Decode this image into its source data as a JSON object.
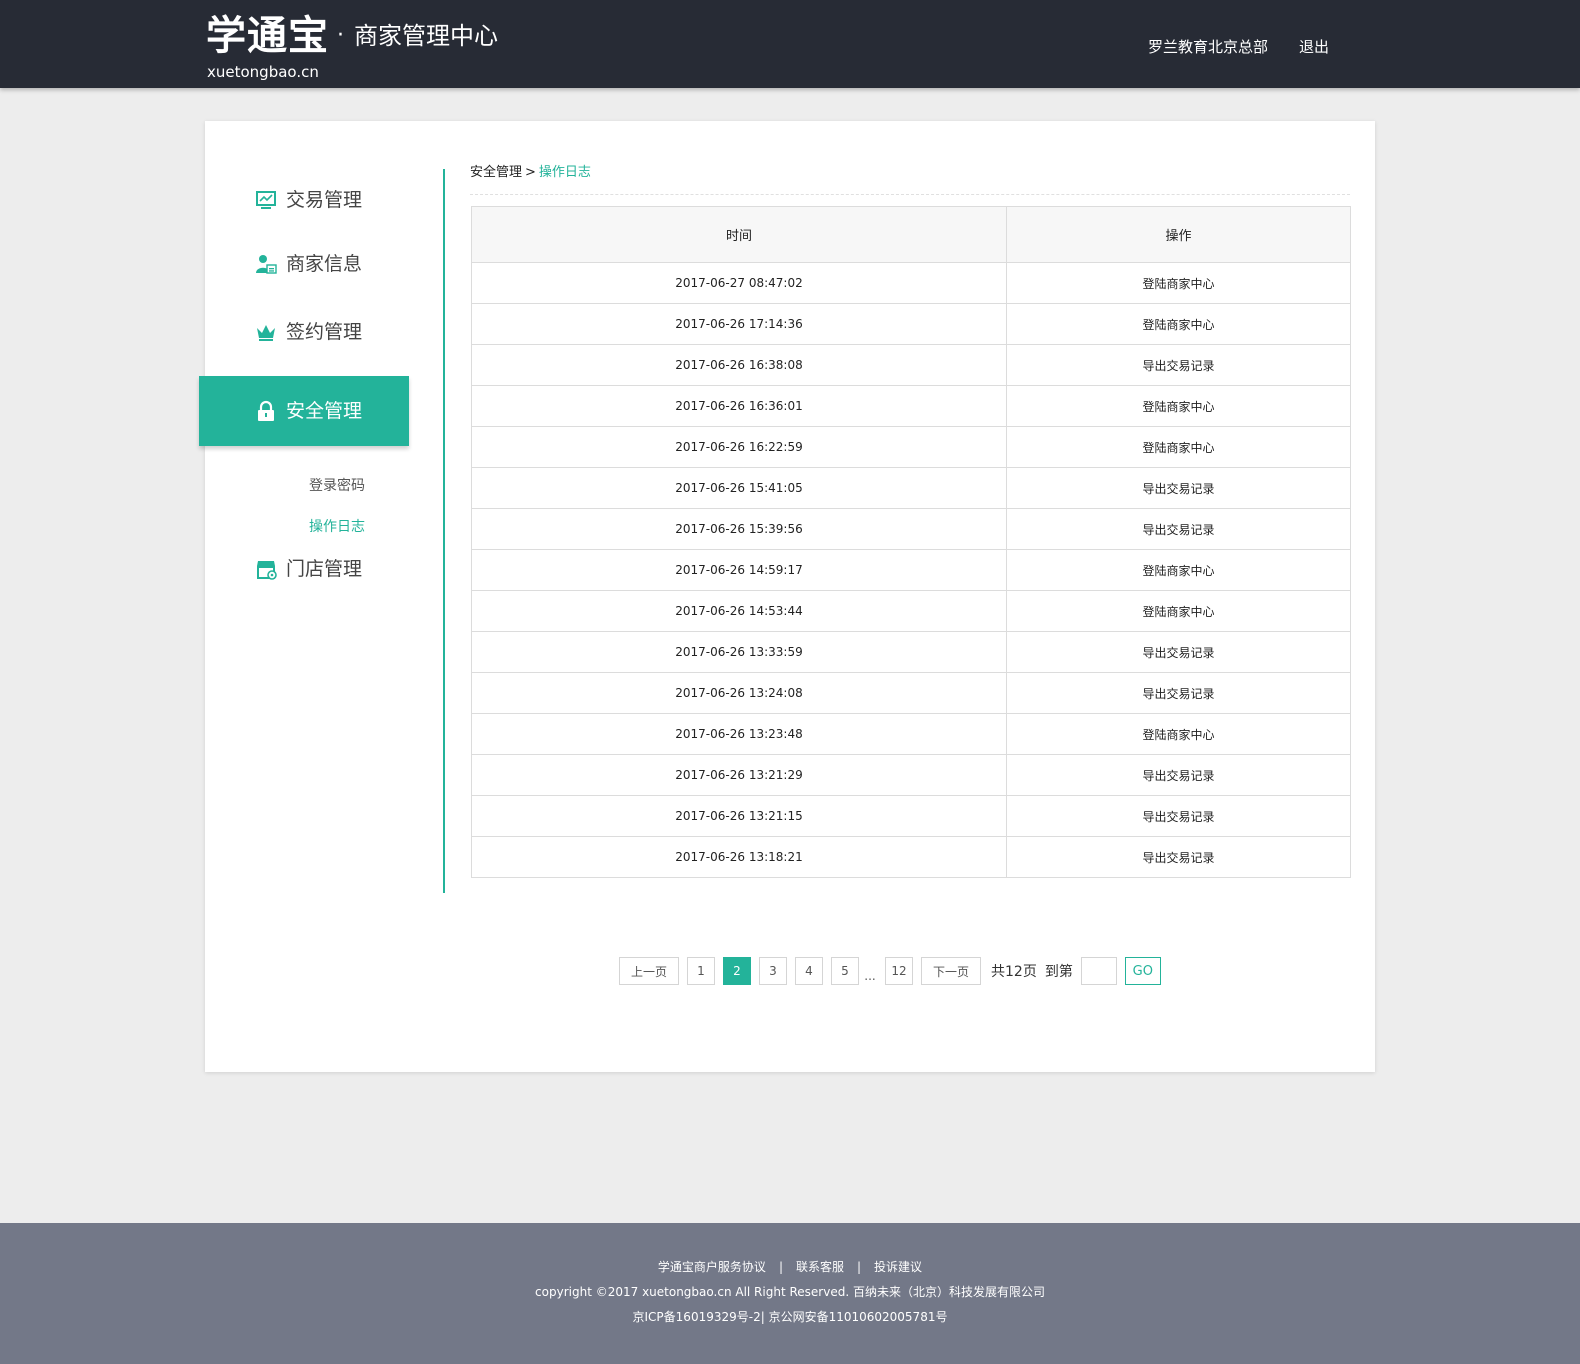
{
  "header": {
    "logo_main": "学通宝",
    "logo_dot": "·",
    "logo_sub": "商家管理中心",
    "logo_domain": "xuetongbao.cn",
    "org_name": "罗兰教育北京总部",
    "logout_label": "退出"
  },
  "sidebar": {
    "items": [
      {
        "label": "交易管理",
        "icon": "monitor-chart-icon"
      },
      {
        "label": "商家信息",
        "icon": "user-card-icon"
      },
      {
        "label": "签约管理",
        "icon": "crown-icon"
      },
      {
        "label": "安全管理",
        "icon": "lock-icon",
        "active": true
      },
      {
        "label": "门店管理",
        "icon": "store-icon"
      }
    ],
    "sub_items": [
      {
        "label": "登录密码"
      },
      {
        "label": "操作日志",
        "current": true
      }
    ]
  },
  "breadcrumb": {
    "parent": "安全管理",
    "separator": ">",
    "current": "操作日志"
  },
  "table": {
    "headers": [
      "时间",
      "操作"
    ],
    "rows": [
      [
        "2017-06-27 08:47:02",
        "登陆商家中心"
      ],
      [
        "2017-06-26 17:14:36",
        "登陆商家中心"
      ],
      [
        "2017-06-26 16:38:08",
        "导出交易记录"
      ],
      [
        "2017-06-26 16:36:01",
        "登陆商家中心"
      ],
      [
        "2017-06-26 16:22:59",
        "登陆商家中心"
      ],
      [
        "2017-06-26 15:41:05",
        "导出交易记录"
      ],
      [
        "2017-06-26 15:39:56",
        "导出交易记录"
      ],
      [
        "2017-06-26 14:59:17",
        "登陆商家中心"
      ],
      [
        "2017-06-26 14:53:44",
        "登陆商家中心"
      ],
      [
        "2017-06-26 13:33:59",
        "导出交易记录"
      ],
      [
        "2017-06-26 13:24:08",
        "导出交易记录"
      ],
      [
        "2017-06-26 13:23:48",
        "登陆商家中心"
      ],
      [
        "2017-06-26 13:21:29",
        "导出交易记录"
      ],
      [
        "2017-06-26 13:21:15",
        "导出交易记录"
      ],
      [
        "2017-06-26 13:18:21",
        "导出交易记录"
      ]
    ]
  },
  "pagination": {
    "prev_label": "上一页",
    "pages": [
      "1",
      "2",
      "3",
      "4",
      "5"
    ],
    "current_page": "2",
    "ellipsis": "...",
    "last_page": "12",
    "next_label": "下一页",
    "total_label": "共12页",
    "goto_label": "到第",
    "go_label": "GO"
  },
  "footer": {
    "links": [
      "学通宝商户服务协议",
      "联系客服",
      "投诉建议"
    ],
    "link_separator": "|",
    "copyright": "copyright ©2017 xuetongbao.cn All Right Reserved. 百纳未来（北京）科技发展有限公司",
    "icp": "京ICP备16019329号-2| 京公网安备11010602005781号"
  },
  "colors": {
    "accent": "#23b39a",
    "header_bg": "#272b35",
    "footer_bg": "#737888",
    "page_bg": "#ededed"
  }
}
